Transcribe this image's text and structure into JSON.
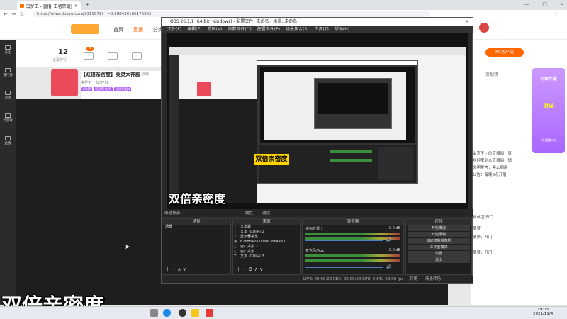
{
  "browser": {
    "tab_title": "虫罗王 - 直播_王者荣耀直播_斗鱼",
    "url": "https://www.douyu.com/9115879?_r=0.988430166175952",
    "new_tab": "+"
  },
  "site": {
    "nav": [
      "首页",
      "直播",
      "分类"
    ],
    "pc_client": "PC客户端"
  },
  "sidebar": {
    "items": [
      {
        "label": "关注"
      },
      {
        "label": "排行榜"
      },
      {
        "label": "游戏"
      },
      {
        "label": "云游戏"
      },
      {
        "label": "直播"
      }
    ]
  },
  "stats": {
    "value": "12",
    "label": "土豪排行",
    "level_badge": "4"
  },
  "streamer": {
    "title": "【双倍亲密度】英灵大神殿",
    "tag": "领取",
    "name": "虫罗王",
    "fans": "629799",
    "badge1": "V助教",
    "badge2": "超级粉丝牌",
    "badge3": "超级粉丝4"
  },
  "obs": {
    "title": "OBS 26.1.1 (64-bit, windows) - 配置文件: 未命名 - 场景: 未命名",
    "menu": [
      "文件(F)",
      "编辑(E)",
      "视图(V)",
      "停靠部件(D)",
      "配置文件(P)",
      "场景集合(S)",
      "工具(T)",
      "帮助(H)"
    ],
    "controls_left": "未选择源",
    "controls_props": "属性",
    "controls_filter": "滤镜",
    "docks": {
      "scenes": "场景",
      "scene_item": "场景",
      "sources": "来源",
      "mixer": "混音器",
      "controls": "控件"
    },
    "sources": [
      "文本转",
      "文本 (GDI+) 2",
      "显示器采集",
      "b268b42a2ad8b26b4a83",
      "窗口采集 2",
      "窗口采集",
      "文本 (GDI+) 3"
    ],
    "mixer": [
      {
        "name": "桌面音频 1",
        "db": "0.0 dB"
      },
      {
        "name": "麦克风/Aux",
        "db": "0.0 dB"
      }
    ],
    "buttons": [
      "开始推流",
      "开始录制",
      "启动虚拟摄像机",
      "工作室模式",
      "设置",
      "退出"
    ],
    "transition_label": "转场",
    "transition_value": "场景转场",
    "status": "LIVE: 00:00:00   REC: 00:00:00   CPU: 5.6%, 60.00 fps"
  },
  "nested_caption": "双倍亲密度",
  "subtitle_mid": "双倍亲密度",
  "subtitle_big": "双倍亲密度",
  "right_panel": {
    "header": "贡献榜",
    "chat": [
      "虫罗王 - 的直播间，直",
      "欢迎来到本直播间，请",
      "文明发言，禁止刷屏",
      "公告：每晚8点开播",
      "粉丝团 开门",
      "萝萝",
      "萝萝，开门",
      "萝萝，开门"
    ],
    "promo_top": "斗鱼年度",
    "promo_mid": "时尚",
    "promo_bottom": "立即参与"
  },
  "taskbar": {
    "time": "19:03",
    "date": "2021/11/4"
  }
}
